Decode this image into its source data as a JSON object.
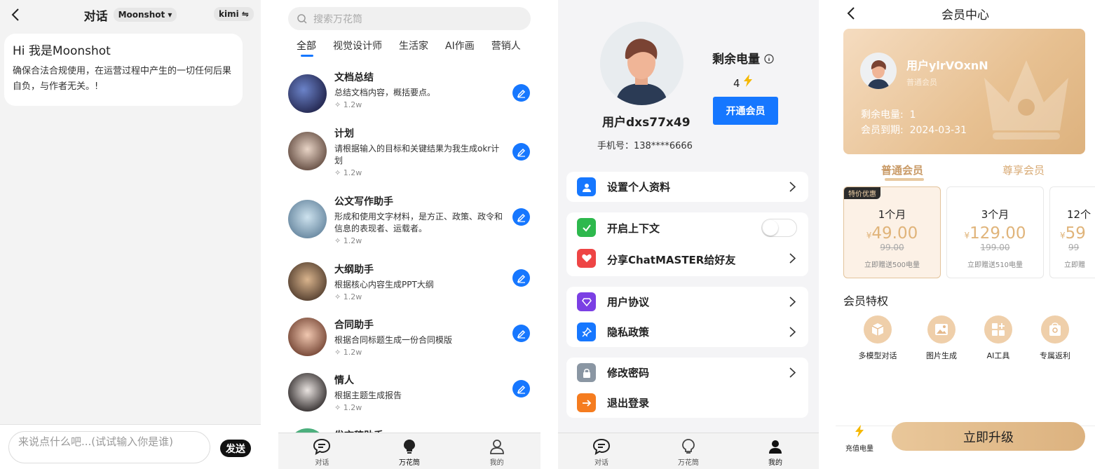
{
  "chat": {
    "title": "对话",
    "model": "Moonshot ▾",
    "kimi": "kimi ⇋",
    "greeting_title": "Hi 我是Moonshot",
    "greeting_text": "确保合法合规使用，在运营过程中产生的一切任何后果自负，与作者无关。!",
    "input_placeholder": "来说点什么吧...(试试输入你是谁)",
    "send_label": "发送"
  },
  "kaleido": {
    "search_placeholder": "搜索万花筒",
    "tabs": [
      "全部",
      "视觉设计师",
      "生活家",
      "AI作画",
      "营销人"
    ],
    "items": [
      {
        "name": "文档总结",
        "desc": "总结文档内容，概括要点。",
        "count": "1.2w"
      },
      {
        "name": "计划",
        "desc": "请根据输入的目标和关键结果为我生成okr计划",
        "count": "1.2w"
      },
      {
        "name": "公文写作助手",
        "desc": "形成和使用文字材料，是方正、政策、政令和信息的表现者、运载者。",
        "count": "1.2w"
      },
      {
        "name": "大纲助手",
        "desc": "根据核心内容生成PPT大纲",
        "count": "1.2w"
      },
      {
        "name": "合同助手",
        "desc": "根据合同标题生成一份合同模版",
        "count": "1.2w"
      },
      {
        "name": "情人",
        "desc": "根据主题生成报告",
        "count": "1.2w"
      },
      {
        "name": "发言稿助手",
        "desc": "",
        "count": ""
      }
    ]
  },
  "nav": {
    "chat": "对话",
    "kaleido": "万花筒",
    "mine": "我的"
  },
  "profile": {
    "username": "用户dxs77x49",
    "phone": "手机号：138****6666",
    "power_title": "剩余电量",
    "power_value": "4",
    "vip_button": "开通会员",
    "rows": {
      "settings": "设置个人资料",
      "context": "开启上下文",
      "share": "分享ChatMASTER给好友",
      "agreement": "用户协议",
      "privacy": "隐私政策",
      "password": "修改密码",
      "logout": "退出登录"
    }
  },
  "member": {
    "title": "会员中心",
    "username": "用户ylrVOxnN",
    "level": "普通会员",
    "power_label": "剩余电量:",
    "power_value": "1",
    "expire_label": "会员到期:",
    "expire_value": "2024-03-31",
    "tabs": [
      "普通会员",
      "尊享会员"
    ],
    "plans": [
      {
        "badge": "特价优惠",
        "term": "1个月",
        "currency": "¥",
        "price": "49.00",
        "old": "99.00",
        "gift": "立即赠送500电量"
      },
      {
        "badge": "",
        "term": "3个月",
        "currency": "¥",
        "price": "129.00",
        "old": "199.00",
        "gift": "立即赠送510电量"
      },
      {
        "badge": "",
        "term": "12个",
        "currency": "¥",
        "price": "59",
        "old": "99",
        "gift": "立即赠"
      }
    ],
    "privileges_title": "会员特权",
    "privileges": [
      "多模型对话",
      "图片生成",
      "AI工具",
      "专属返利"
    ],
    "recharge_label": "充值电量",
    "upgrade_label": "立即升级"
  }
}
